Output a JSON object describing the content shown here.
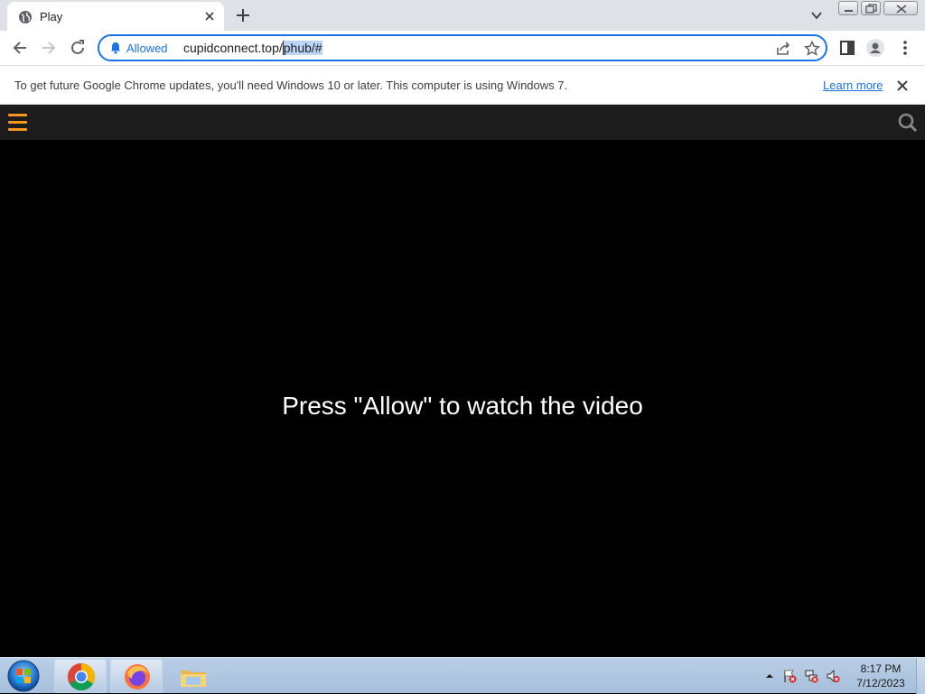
{
  "browser": {
    "tab": {
      "title": "Play",
      "favicon": "globe-icon"
    },
    "address": {
      "permission_label": "Allowed",
      "url_plain": "cupidconnect.top/",
      "url_selected": "phub/#"
    },
    "accent_color": "#1a73e8"
  },
  "infobar": {
    "message": "To get future Google Chrome updates, you'll need Windows 10 or later. This computer is using Windows 7.",
    "link": "Learn more"
  },
  "page": {
    "prompt": "Press \"Allow\" to watch the video",
    "menu_color": "#f7971e"
  },
  "taskbar": {
    "apps": [
      "chrome-icon",
      "firefox-icon",
      "file-explorer-icon"
    ],
    "time": "8:17 PM",
    "date": "7/12/2023"
  }
}
